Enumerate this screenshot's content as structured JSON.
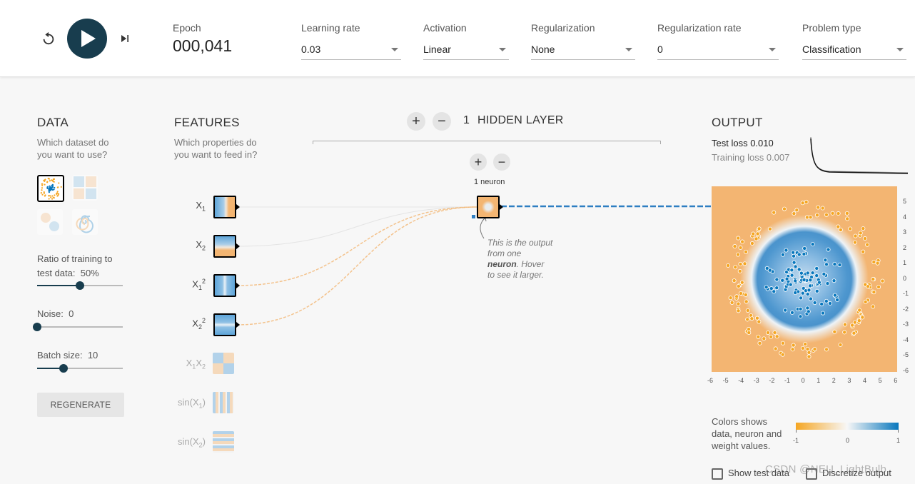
{
  "controls": {
    "reset_icon": "reset-icon",
    "play_icon": "play-icon",
    "step_icon": "step-icon",
    "epoch_label": "Epoch",
    "epoch_value": "000,041",
    "learning_rate": {
      "label": "Learning rate",
      "value": "0.03"
    },
    "activation": {
      "label": "Activation",
      "value": "Linear"
    },
    "regularization": {
      "label": "Regularization",
      "value": "None"
    },
    "regularization_rate": {
      "label": "Regularization rate",
      "value": "0"
    },
    "problem_type": {
      "label": "Problem type",
      "value": "Classification"
    }
  },
  "data_panel": {
    "title": "DATA",
    "subtitle_line1": "Which dataset do",
    "subtitle_line2": "you want to use?",
    "datasets": [
      "circle",
      "xor",
      "gaussian",
      "spiral"
    ],
    "selected_dataset": "circle",
    "ratio_label_line1": "Ratio of training to",
    "ratio_label_line2": "test data:",
    "ratio_value": "50%",
    "ratio_fraction": 0.5,
    "noise_label": "Noise:",
    "noise_value": "0",
    "noise_fraction": 0.0,
    "batch_label": "Batch size:",
    "batch_value": "10",
    "batch_fraction": 0.31,
    "regenerate_label": "REGENERATE"
  },
  "features_panel": {
    "title": "FEATURES",
    "subtitle_line1": "Which properties do",
    "subtitle_line2": "you want to feed in?",
    "features": [
      {
        "label": "X",
        "sub": "1",
        "sup": "",
        "active": true
      },
      {
        "label": "X",
        "sub": "2",
        "sup": "",
        "active": true
      },
      {
        "label": "X",
        "sub": "1",
        "sup": "2",
        "active": true
      },
      {
        "label": "X",
        "sub": "2",
        "sup": "2",
        "active": true
      },
      {
        "label": "X",
        "sub": "1",
        "sup": "",
        "label2": "X",
        "sub2": "2",
        "active": false
      },
      {
        "label": "sin(X",
        "sub": "1",
        "sup": "",
        "tail": ")",
        "active": false
      },
      {
        "label": "sin(X",
        "sub": "2",
        "sup": "",
        "tail": ")",
        "active": false
      }
    ]
  },
  "network": {
    "add_layer_icon": "plus-icon",
    "remove_layer_icon": "minus-icon",
    "layer_count": "1",
    "layer_title": "HIDDEN LAYER",
    "add_neuron_icon": "plus-icon",
    "remove_neuron_icon": "minus-icon",
    "neuron_count_label": "1 neuron",
    "callout_line1": "This is the output",
    "callout_line2": "from one",
    "callout_bold": "neuron",
    "callout_line3": ". Hover",
    "callout_line4": "to see it larger."
  },
  "output_panel": {
    "title": "OUTPUT",
    "test_loss_label": "Test loss",
    "test_loss_value": "0.010",
    "training_loss_label": "Training loss",
    "training_loss_value": "0.007",
    "x_ticks": [
      "-6",
      "-5",
      "-4",
      "-3",
      "-2",
      "-1",
      "0",
      "1",
      "2",
      "3",
      "4",
      "5",
      "6"
    ],
    "y_ticks": [
      "5",
      "4",
      "3",
      "2",
      "1",
      "0",
      "-1",
      "-2",
      "-3",
      "-4",
      "-5",
      "-6"
    ],
    "legend_line1": "Colors shows",
    "legend_line2": "data, neuron and",
    "legend_line3": "weight values.",
    "legend_min": "-1",
    "legend_mid": "0",
    "legend_max": "1",
    "show_test_data_label": "Show test data",
    "discretize_label": "Discretize output",
    "watermark": "CSDN @NEU_LightBulb"
  },
  "colors": {
    "orange": "#f5a623",
    "orange_light": "#f3b572",
    "blue": "#0877bd",
    "dark_teal": "#183d4e"
  }
}
